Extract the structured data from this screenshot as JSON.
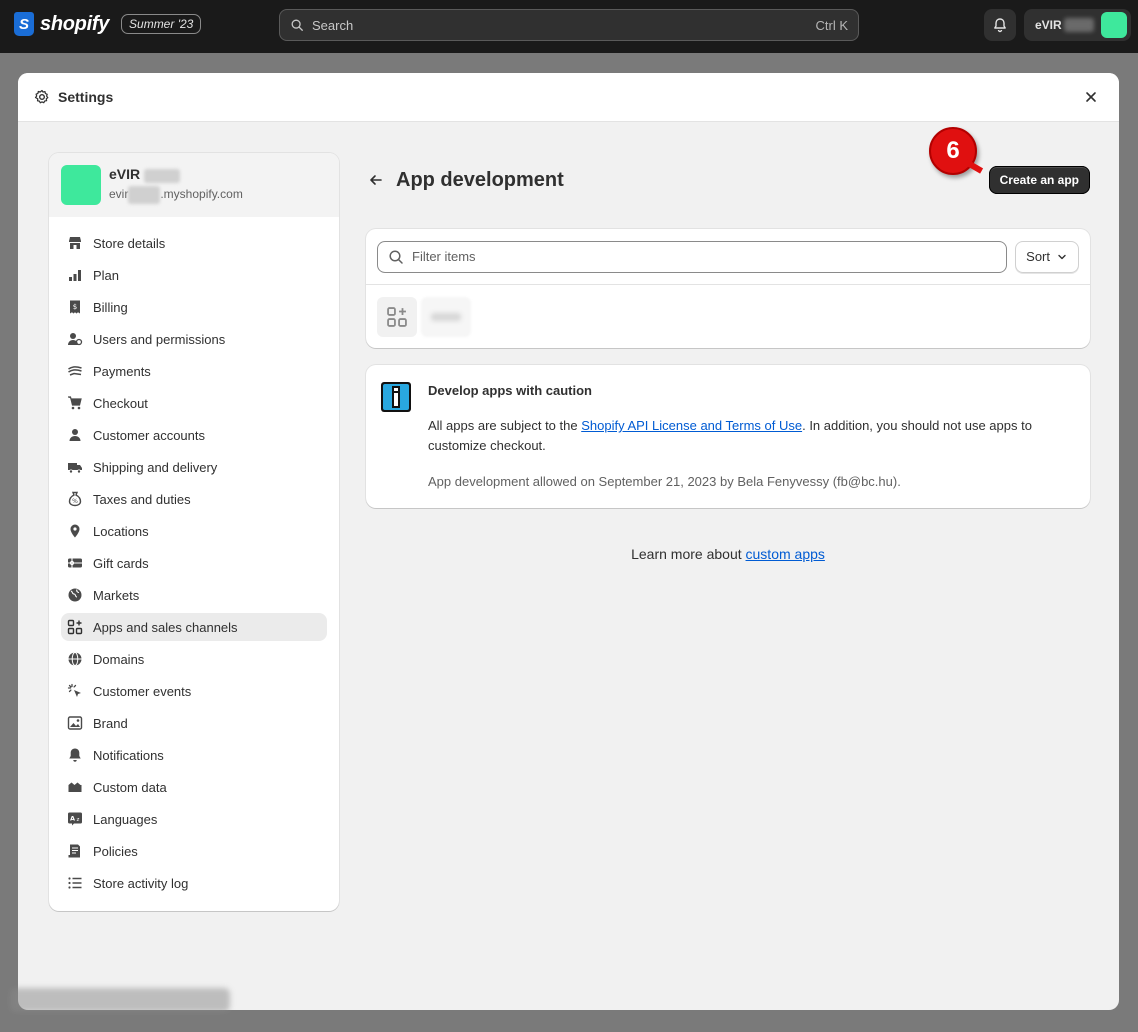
{
  "topbar": {
    "logo_text": "shopify",
    "edition_badge": "Summer '23",
    "search_placeholder": "Search",
    "search_shortcut": "Ctrl K",
    "account_name": "eVIR"
  },
  "modal": {
    "title": "Settings"
  },
  "sidebar": {
    "store_name": "eVIR",
    "store_domain_prefix": "evir",
    "store_domain_suffix": ".myshopify.com",
    "items": [
      {
        "label": "Store details",
        "icon": "store-icon"
      },
      {
        "label": "Plan",
        "icon": "plan-icon"
      },
      {
        "label": "Billing",
        "icon": "billing-icon"
      },
      {
        "label": "Users and permissions",
        "icon": "users-icon"
      },
      {
        "label": "Payments",
        "icon": "payments-icon"
      },
      {
        "label": "Checkout",
        "icon": "cart-icon"
      },
      {
        "label": "Customer accounts",
        "icon": "person-icon"
      },
      {
        "label": "Shipping and delivery",
        "icon": "truck-icon"
      },
      {
        "label": "Taxes and duties",
        "icon": "tax-icon"
      },
      {
        "label": "Locations",
        "icon": "location-pin-icon"
      },
      {
        "label": "Gift cards",
        "icon": "gift-card-icon"
      },
      {
        "label": "Markets",
        "icon": "globe-icon"
      },
      {
        "label": "Apps and sales channels",
        "icon": "apps-icon"
      },
      {
        "label": "Domains",
        "icon": "domain-globe-icon"
      },
      {
        "label": "Customer events",
        "icon": "cursor-click-icon"
      },
      {
        "label": "Brand",
        "icon": "brand-icon"
      },
      {
        "label": "Notifications",
        "icon": "bell-icon"
      },
      {
        "label": "Custom data",
        "icon": "custom-data-icon"
      },
      {
        "label": "Languages",
        "icon": "language-icon"
      },
      {
        "label": "Policies",
        "icon": "policies-icon"
      },
      {
        "label": "Store activity log",
        "icon": "list-icon"
      }
    ],
    "active_item": "Apps and sales channels"
  },
  "main": {
    "page_title": "App development",
    "create_button": "Create an app",
    "step_number": "6",
    "filter_placeholder": "Filter items",
    "sort_label": "Sort",
    "caution": {
      "title": "Develop apps with caution",
      "text_before": "All apps are subject to the ",
      "link": "Shopify API License and Terms of Use",
      "text_after": ". In addition, you should not use apps to customize checkout.",
      "meta": "App development allowed on September 21, 2023 by Bela Fenyvessy (fb@bc.hu)."
    },
    "learn_more_prefix": "Learn more about ",
    "learn_more_link": "custom apps"
  },
  "colors": {
    "topbar": "#1a1a1a",
    "accent_link": "#005bd3",
    "store_avatar": "#3ee89c",
    "step_badge": "#e01010",
    "primary_button": "#303030"
  }
}
